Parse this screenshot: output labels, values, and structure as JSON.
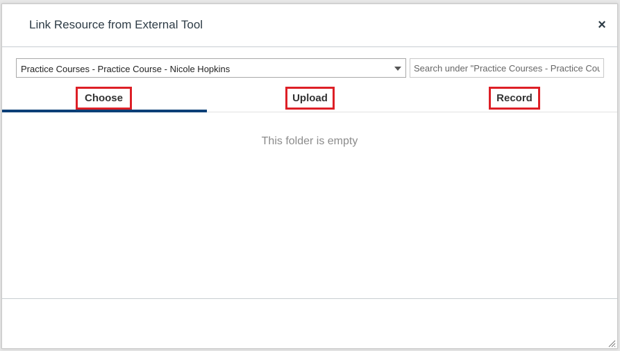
{
  "dialog": {
    "title": "Link Resource from External Tool",
    "close_symbol": "×"
  },
  "folder_select": {
    "selected": "Practice Courses - Practice Course - Nicole Hopkins",
    "icon": "chevron-down-icon"
  },
  "search": {
    "placeholder": "Search under \"Practice Courses - Practice Course - Nicole Hopkins\""
  },
  "tabs": [
    {
      "label": "Choose",
      "active": true
    },
    {
      "label": "Upload",
      "active": false
    },
    {
      "label": "Record",
      "active": false
    }
  ],
  "content": {
    "empty_message": "This folder is empty"
  },
  "colors": {
    "active_tab_underline": "#0b3f77",
    "highlight_box": "#dd1f26"
  }
}
